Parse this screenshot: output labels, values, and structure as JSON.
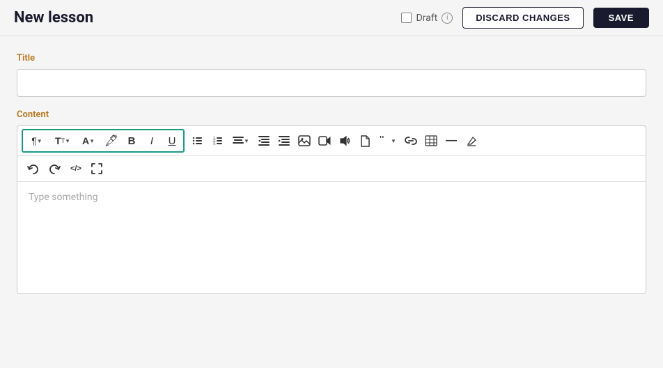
{
  "header": {
    "title": "New lesson",
    "draft_label": "Draft",
    "discard_label": "DISCARD CHANGES",
    "save_label": "SAVE"
  },
  "form": {
    "title_label": "Title",
    "title_placeholder": "",
    "content_label": "Content",
    "editor_placeholder": "Type something"
  },
  "toolbar": {
    "paragraph_icon": "¶",
    "text_size_icon": "T",
    "font_icon": "A",
    "color_icon": "🎨",
    "bold_icon": "B",
    "italic_icon": "I",
    "underline_icon": "U",
    "bullet_list_icon": "☰",
    "ordered_list_icon": "≡",
    "align_icon": "≡",
    "outdent_icon": "⇐",
    "indent_icon": "⇒",
    "image_icon": "🖼",
    "video_icon": "▶",
    "audio_icon": "🔊",
    "file_icon": "📄",
    "quote_icon": "❝",
    "link_icon": "🔗",
    "table_icon": "⊞",
    "hr_icon": "—",
    "eraser_icon": "✏",
    "undo_icon": "↩",
    "redo_icon": "↪",
    "code_icon": "</>",
    "fullscreen_icon": "⤢"
  },
  "icons": {
    "info": "i",
    "check": ""
  }
}
